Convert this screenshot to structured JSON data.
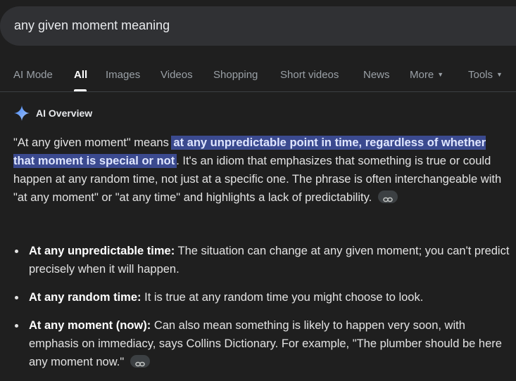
{
  "search": {
    "query": "any given moment meaning"
  },
  "tabs": [
    {
      "label": "AI Mode"
    },
    {
      "label": "All"
    },
    {
      "label": "Images"
    },
    {
      "label": "Videos"
    },
    {
      "label": "Shopping"
    },
    {
      "label": "Short videos"
    },
    {
      "label": "News"
    },
    {
      "label": "More"
    },
    {
      "label": "Tools"
    }
  ],
  "overview": {
    "title": "AI Overview",
    "icon": "gemini-sparkle-icon",
    "para_start": "\"At any given moment\" means ",
    "para_highlight": "at any unpredictable point in time, regardless of whether that moment is special or not",
    "para_end": ". It's an idiom that emphasizes that something is true or could happen at any random time, not just at a specific one. The phrase is often interchangeable with \"at any moment\" or \"at any time\" and highlights a lack of predictability."
  },
  "bullets": [
    {
      "term": "At any unpredictable time:",
      "text": " The situation can change at any given moment; you can't predict precisely when it will happen."
    },
    {
      "term": "At any random time:",
      "text": " It is true at any random time you might choose to look."
    },
    {
      "term": "At any moment (now):",
      "text": " Can also mean something is likely to happen very soon, with emphasis on immediacy, says Collins Dictionary. For example, \"The plumber should be here any moment now.\""
    }
  ],
  "colors": {
    "background": "#1f1f1f",
    "highlight": "#3b4a8f",
    "sparkle_start": "#4285f4",
    "sparkle_end": "#a8c7fa"
  }
}
